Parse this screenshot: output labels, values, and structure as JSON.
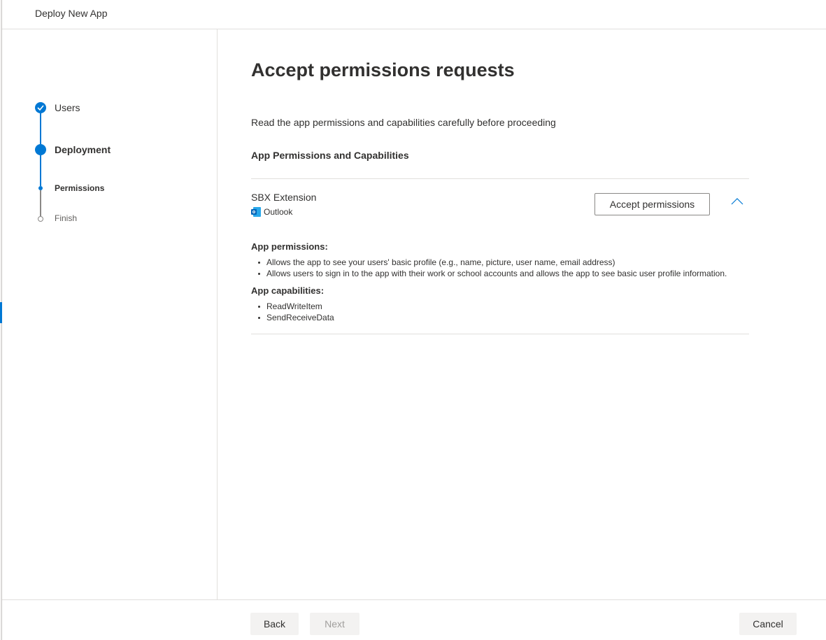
{
  "header": {
    "title": "Deploy New App"
  },
  "stepper": {
    "steps": [
      {
        "label": "Users",
        "state": "completed"
      },
      {
        "label": "Deployment",
        "state": "current"
      },
      {
        "label": "Permissions",
        "state": "current-substep"
      },
      {
        "label": "Finish",
        "state": "not-started"
      }
    ]
  },
  "main": {
    "title": "Accept permissions requests",
    "intro": "Read the app permissions and capabilities carefully before proceeding",
    "section_title": "App Permissions and Capabilities",
    "app": {
      "name": "SBX Extension",
      "host": "Outlook",
      "host_icon": "outlook-icon",
      "accept_label": "Accept permissions",
      "expanded": true,
      "permissions_heading": "App permissions:",
      "permissions": [
        "Allows the app to see your users' basic profile (e.g., name, picture, user name, email address)",
        "Allows users to sign in to the app with their work or school accounts and allows the app to see basic user profile information."
      ],
      "capabilities_heading": "App capabilities:",
      "capabilities": [
        "ReadWriteItem",
        "SendReceiveData"
      ]
    }
  },
  "footer": {
    "back_label": "Back",
    "next_label": "Next",
    "next_disabled": true,
    "cancel_label": "Cancel"
  },
  "colors": {
    "accent": "#0078d4",
    "text": "#323130",
    "divider": "#e1dfdd",
    "button_bg": "#f3f2f1",
    "disabled_text": "#a19f9d"
  }
}
